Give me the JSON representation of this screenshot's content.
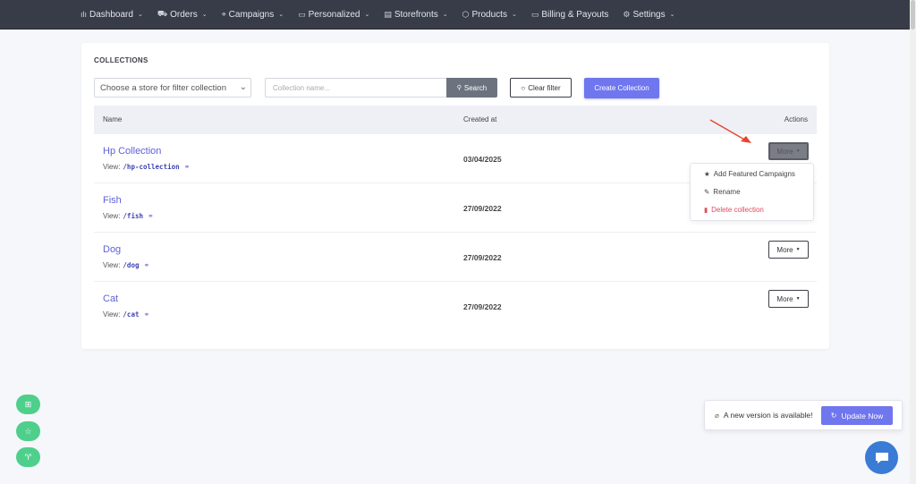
{
  "nav": {
    "items": [
      {
        "icon": "bar-chart-icon",
        "glyph": "ılı",
        "label": "Dashboard"
      },
      {
        "icon": "cart-icon",
        "glyph": "🛒",
        "label": "Orders"
      },
      {
        "icon": "target-icon",
        "glyph": "⌖",
        "label": "Campaigns"
      },
      {
        "icon": "message-icon",
        "glyph": "▭",
        "label": "Personalized"
      },
      {
        "icon": "store-icon",
        "glyph": "▤",
        "label": "Storefronts"
      },
      {
        "icon": "box-icon",
        "glyph": "⬡",
        "label": "Products"
      },
      {
        "icon": "card-icon",
        "glyph": "▭",
        "label": "Billing & Payouts"
      },
      {
        "icon": "gear-icon",
        "glyph": "⚙",
        "label": "Settings"
      }
    ]
  },
  "page": {
    "title": "COLLECTIONS",
    "store_select": "Choose a store for filter collection",
    "name_placeholder": "Collection name...",
    "search_label": "Search",
    "clear_label": "Clear filter",
    "create_label": "Create Collection"
  },
  "table": {
    "headers": {
      "name": "Name",
      "created": "Created at",
      "actions": "Actions"
    },
    "view_prefix": "View:",
    "more_label": "More",
    "rows": [
      {
        "name": "Hp Collection",
        "path": "/hp-collection",
        "date": "03/04/2025"
      },
      {
        "name": "Fish",
        "path": "/fish",
        "date": "27/09/2022"
      },
      {
        "name": "Dog",
        "path": "/dog",
        "date": "27/09/2022"
      },
      {
        "name": "Cat",
        "path": "/cat",
        "date": "27/09/2022"
      }
    ]
  },
  "dropdown": {
    "items": [
      {
        "label": "Add Featured Campaigns",
        "icon": "star-icon"
      },
      {
        "label": "Rename",
        "icon": "pencil-icon"
      },
      {
        "label": "Delete collection",
        "icon": "trash-icon"
      }
    ]
  },
  "toast": {
    "text": "A new version is available!",
    "button": "Update Now"
  },
  "colors": {
    "nav_bg": "#373c48",
    "accent": "#6f76ee",
    "link": "#5d62d9",
    "danger": "#e24a5f",
    "fab": "#4fcf8c",
    "chat": "#3a7bd5",
    "annotation_arrow": "#e4472d"
  }
}
